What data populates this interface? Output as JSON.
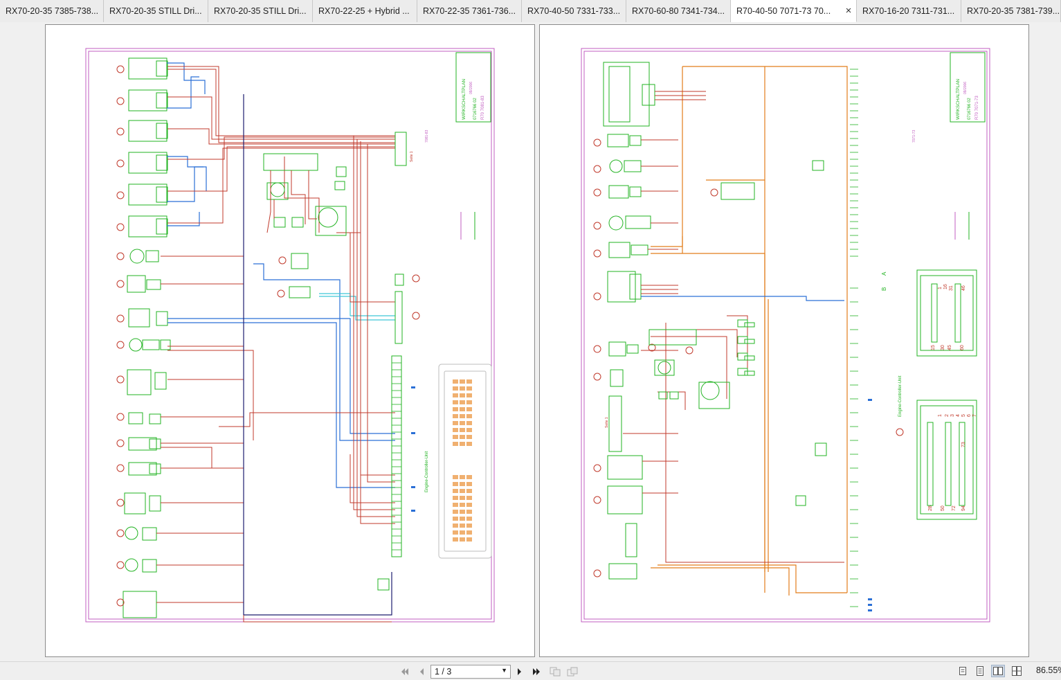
{
  "tabs": [
    {
      "label": "RX70-20-35 7385-738...",
      "active": false
    },
    {
      "label": "RX70-20-35 STILL Dri...",
      "active": false
    },
    {
      "label": "RX70-20-35 STILL Dri...",
      "active": false
    },
    {
      "label": "RX70-22-25 + Hybrid ...",
      "active": false
    },
    {
      "label": "RX70-22-35 7361-736...",
      "active": false
    },
    {
      "label": "RX70-40-50 7331-733...",
      "active": false
    },
    {
      "label": "RX70-60-80 7341-734...",
      "active": false
    },
    {
      "label": "R70-40-50 7071-73 70...",
      "active": true
    },
    {
      "label": "RX70-16-20 7311-731...",
      "active": false
    },
    {
      "label": "RX70-20-35 7381-739...",
      "active": false
    }
  ],
  "close_glyph": "×",
  "pages": [
    {
      "title_block": {
        "title": "WIRKSCHALTPLAN",
        "date": "09/2006",
        "doc_no": "0716766 02",
        "model": "R70 7081-83"
      },
      "ecu_label": "Engine-Controller-Unit",
      "seite_label": "Seite 1",
      "connector_label": "7081-83"
    },
    {
      "title_block": {
        "title": "WIRKSCHALTPLAN",
        "date": "09/2006",
        "doc_no": "0716766 02",
        "model": "R70 7071-73"
      },
      "ecu_label": "Engine-Controller-Unit",
      "seite_label": "Seite 1",
      "connector_label": "7071-73",
      "pin_block_a": [
        "1",
        "16",
        "31",
        "46",
        "15",
        "30",
        "45",
        "60"
      ],
      "pin_block_b": [
        "1",
        "2",
        "3",
        "4",
        "5",
        "6",
        "7",
        "28",
        "50",
        "72",
        "94",
        "73"
      ],
      "letters": [
        "A",
        "B"
      ]
    }
  ],
  "toolbar": {
    "page_indicator": "1 / 3",
    "zoom": "86.55%",
    "icons": [
      "first-page-icon",
      "prev-page-icon",
      "next-page-icon",
      "last-page-icon",
      "go-back-view-icon",
      "go-forward-view-icon",
      "single-page-view-icon",
      "continuous-view-icon",
      "two-page-view-icon",
      "two-page-continuous-view-icon"
    ]
  },
  "colors": {
    "wire_red": "#c0392b",
    "wire_blue": "#2a6fd6",
    "wire_green": "#22b322",
    "wire_orange": "#e27d1a",
    "frame_magenta": "#c05cc0",
    "wire_navy": "#1c1c6e",
    "wire_cyan": "#3fc8d8"
  }
}
